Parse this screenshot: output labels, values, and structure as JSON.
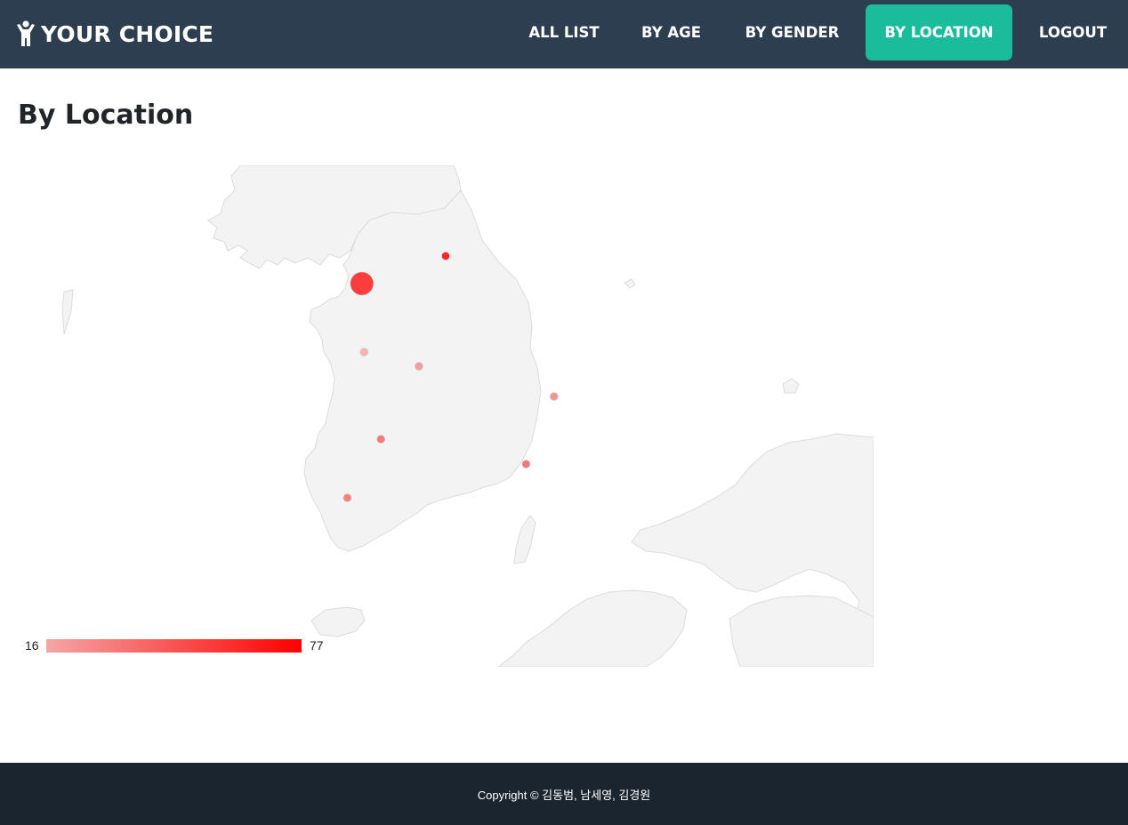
{
  "navbar": {
    "brand": "YOUR CHOICE",
    "links": [
      {
        "label": "ALL LIST"
      },
      {
        "label": "BY AGE"
      },
      {
        "label": "BY GENDER"
      },
      {
        "label": "BY LOCATION",
        "active": true
      },
      {
        "label": "LOGOUT"
      }
    ],
    "colors": {
      "background": "#2c3e50",
      "active": "#1abc9c",
      "text": "#ffffff"
    }
  },
  "page": {
    "title": "By Location"
  },
  "chart_data": {
    "type": "geo-markers",
    "region": "South Korea",
    "color_axis": {
      "min": 16,
      "max": 77,
      "min_color": "#f4a6a6",
      "max_color": "#ff0000"
    },
    "land_color": "#f3f3f3",
    "markers": [
      {
        "lat": 37.57,
        "lon": 126.98,
        "value": 77,
        "size": "large"
      },
      {
        "lat": 37.88,
        "lon": 127.73,
        "value": 77,
        "size": "small"
      },
      {
        "lat": 36.8,
        "lon": 127.0,
        "value": 16,
        "size": "small"
      },
      {
        "lat": 36.64,
        "lon": 127.49,
        "value": 25,
        "size": "small"
      },
      {
        "lat": 36.3,
        "lon": 128.7,
        "value": 30,
        "size": "small"
      },
      {
        "lat": 35.82,
        "lon": 127.15,
        "value": 40,
        "size": "small"
      },
      {
        "lat": 35.54,
        "lon": 128.45,
        "value": 42,
        "size": "small"
      },
      {
        "lat": 35.16,
        "lon": 126.85,
        "value": 38,
        "size": "small"
      }
    ]
  },
  "legend": {
    "min": "16",
    "max": "77"
  },
  "footer": {
    "copyright": "Copyright © 김동범, 남세영, 김경원"
  }
}
